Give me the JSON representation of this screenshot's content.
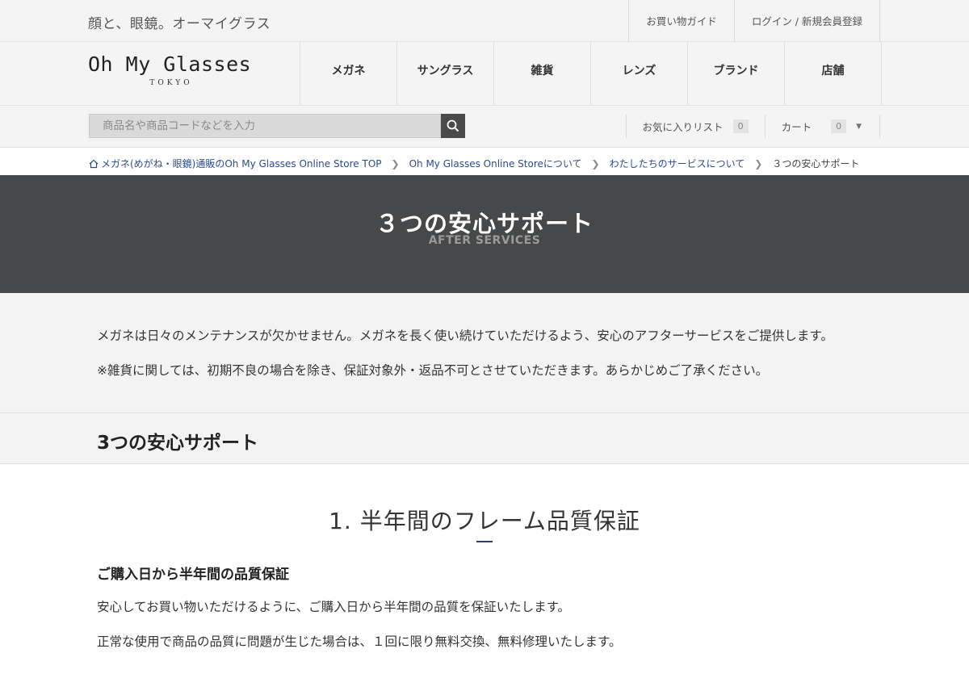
{
  "header": {
    "tagline": "顔と、眼鏡。オーマイグラス",
    "top_links": [
      "お買い物ガイド",
      "ログイン / 新規会員登録"
    ],
    "logo_main": "Oh My Glasses",
    "logo_sub": "TOKYO",
    "nav": [
      "メガネ",
      "サングラス",
      "雑貨",
      "レンズ",
      "ブランド",
      "店舗"
    ]
  },
  "search": {
    "placeholder": "商品名や商品コードなどを入力",
    "icon": "search-icon"
  },
  "utility": {
    "favorites_label": "お気に入りリスト",
    "favorites_count": "0",
    "cart_label": "カート",
    "cart_count": "0",
    "cart_caret": "▼"
  },
  "breadcrumb": {
    "items": [
      "メガネ(めがね・眼鏡)通販のOh My Glasses Online Store TOP",
      "Oh My Glasses Online Storeについて",
      "わたしたちのサービスについて"
    ],
    "current": "３つの安心サポート"
  },
  "hero": {
    "title": "３つの安心サポート",
    "subtitle": "AFTER SERVICES"
  },
  "intro": {
    "p1": "メガネは日々のメンテナンスが欠かせません。メガネを長く使い続けていただけるよう、安心のアフターサービスをご提供します。",
    "p2": "※雑貨に関しては、初期不良の場合を除き、保証対象外・返品不可とさせていただきます。あらかじめご了承ください。"
  },
  "section": {
    "heading": "3つの安心サポート",
    "item_title": "1. 半年間のフレーム品質保証",
    "item_subtitle": "ご購入日から半年間の品質保証",
    "item_p1": "安心してお買い物いただけるように、ご購入日から半年間の品質を保証いたします。",
    "item_p2": "正常な使用で商品の品質に問題が生じた場合は、１回に限り無料交換、無料修理いたします。"
  },
  "colors": {
    "hero_bg": "#464849",
    "link": "#2a4a8a",
    "accent_line": "#2a3f7a"
  }
}
